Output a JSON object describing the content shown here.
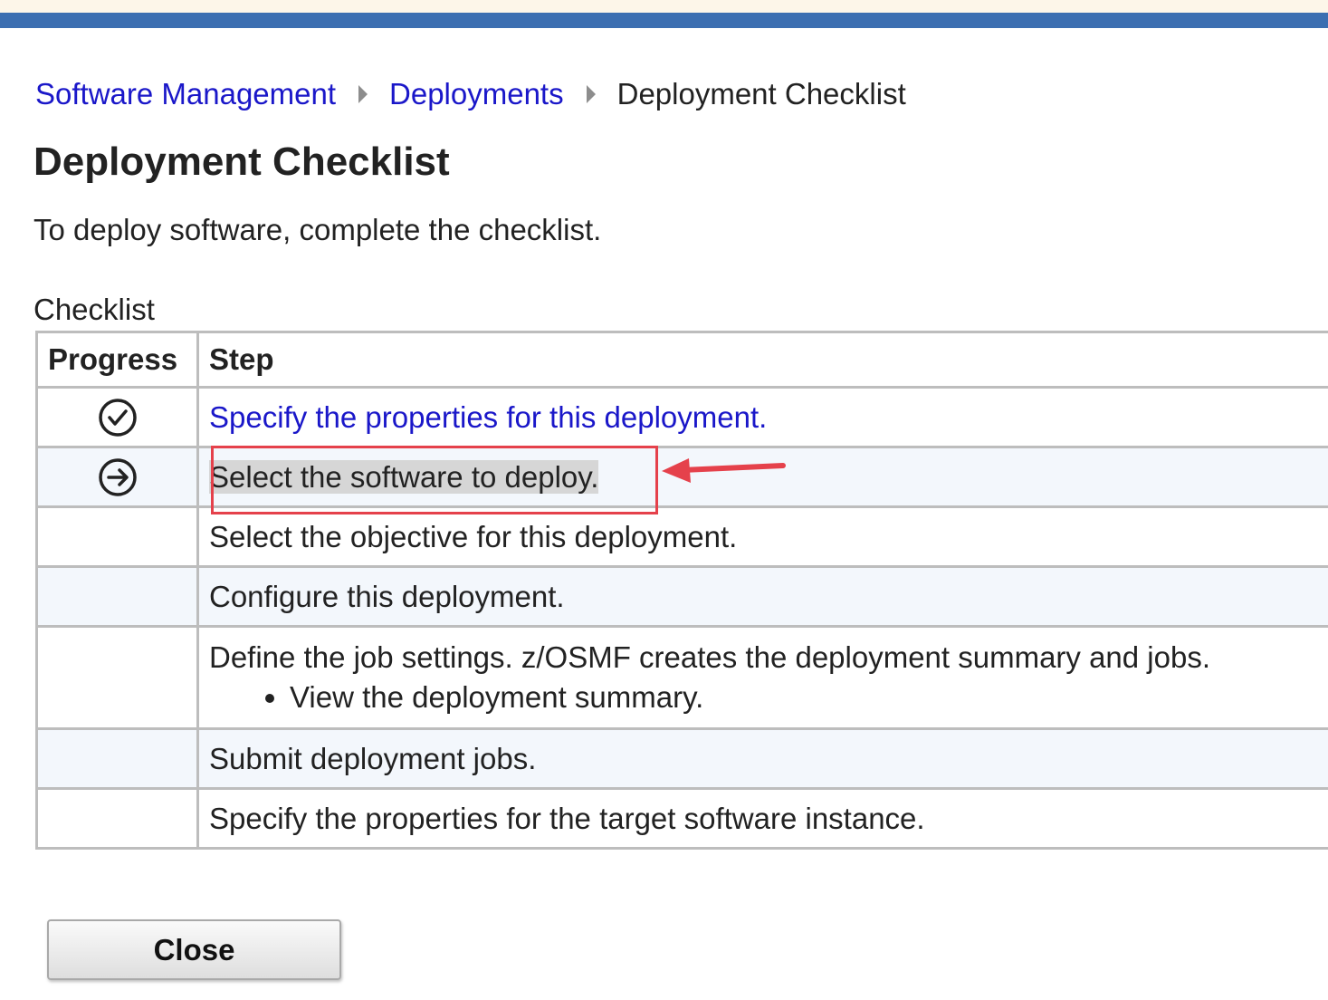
{
  "breadcrumb": {
    "items": [
      {
        "label": "Software Management"
      },
      {
        "label": "Deployments"
      }
    ],
    "current": "Deployment Checklist"
  },
  "page": {
    "title": "Deployment Checklist",
    "intro": "To deploy software, complete the checklist.",
    "table_caption": "Checklist"
  },
  "table": {
    "headers": {
      "progress": "Progress",
      "step": "Step"
    },
    "rows": [
      {
        "status": "completed-check-icon",
        "step": "Specify the properties for this deployment."
      },
      {
        "status": "current-arrow-icon",
        "step": "Select the software to deploy."
      },
      {
        "status": "",
        "step": "Select the objective for this deployment."
      },
      {
        "status": "",
        "step": "Configure this deployment."
      },
      {
        "status": "",
        "step": "Define the job settings. z/OSMF creates the deployment summary and jobs.",
        "substeps": [
          "View the deployment summary."
        ]
      },
      {
        "status": "",
        "step": "Submit deployment jobs."
      },
      {
        "status": "",
        "step": "Specify the properties for the target software instance."
      }
    ]
  },
  "footer": {
    "close_label": "Close"
  },
  "colors": {
    "link": "#1a17c9",
    "header_bar": "#3c6fb1",
    "annotation": "#e5414b",
    "row_alt": "#f3f7fc"
  }
}
